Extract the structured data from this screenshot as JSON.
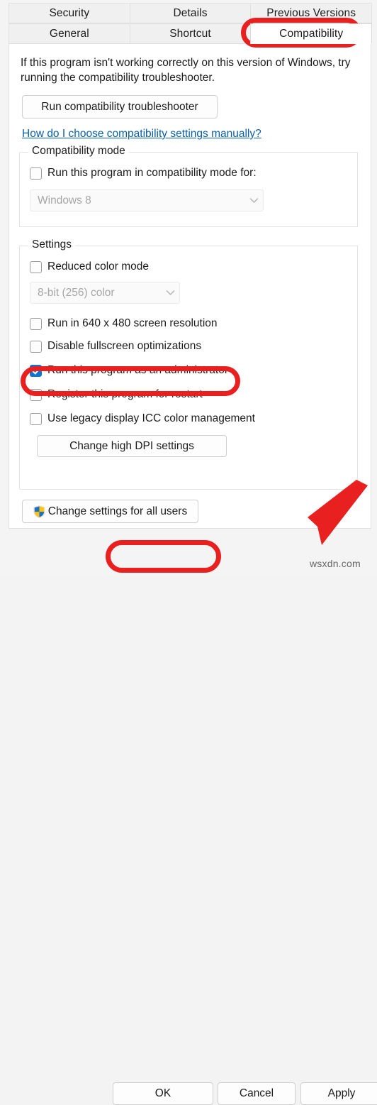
{
  "tabs": {
    "row1": [
      {
        "label": "Security",
        "selected": false
      },
      {
        "label": "Details",
        "selected": false
      },
      {
        "label": "Previous Versions",
        "selected": false
      }
    ],
    "row2": [
      {
        "label": "General",
        "selected": false
      },
      {
        "label": "Shortcut",
        "selected": false
      },
      {
        "label": "Compatibility",
        "selected": true
      }
    ]
  },
  "intro": {
    "text": "If this program isn't working correctly on this version of Windows, try running the compatibility troubleshooter."
  },
  "troubleshooter_button": {
    "label": "Run compatibility troubleshooter"
  },
  "help_link": {
    "label": "How do I choose compatibility settings manually?"
  },
  "compatibility_mode": {
    "title": "Compatibility mode",
    "checkbox": {
      "label": "Run this program in compatibility mode for:",
      "checked": false
    },
    "combo": {
      "value": "Windows 8",
      "enabled": false
    }
  },
  "settings": {
    "title": "Settings",
    "reduced_color": {
      "label": "Reduced color mode",
      "checked": false
    },
    "color_combo": {
      "value": "8-bit (256) color",
      "enabled": false
    },
    "resolution_640": {
      "label": "Run in 640 x 480 screen resolution",
      "checked": false
    },
    "disable_fullscreen": {
      "label": "Disable fullscreen optimizations",
      "checked": false
    },
    "run_as_admin": {
      "label": "Run this program as an administrator",
      "checked": true
    },
    "register_restart": {
      "label": "Register this program for restart",
      "checked": false
    },
    "legacy_icc": {
      "label": "Use legacy display ICC color management",
      "checked": false
    },
    "dpi_button": {
      "label": "Change high DPI settings"
    }
  },
  "change_all_users_button": {
    "label": "Change settings for all users",
    "icon": "uac-shield-icon"
  },
  "footer": {
    "ok": "OK",
    "cancel": "Cancel",
    "apply": "Apply"
  },
  "watermark": {
    "text": "wsxdn.com"
  },
  "annotations": {
    "color": "#e8201f",
    "highlighted": [
      "Compatibility tab",
      "Run this program as an administrator",
      "OK button",
      "Apply button arrow"
    ]
  },
  "colors": {
    "accent_checkbox": "#0d76d4",
    "link": "#0a5fa8",
    "annotation_red": "#e8201f",
    "page_background": "#ffffff",
    "dialog_background": "#f4f4f4"
  }
}
